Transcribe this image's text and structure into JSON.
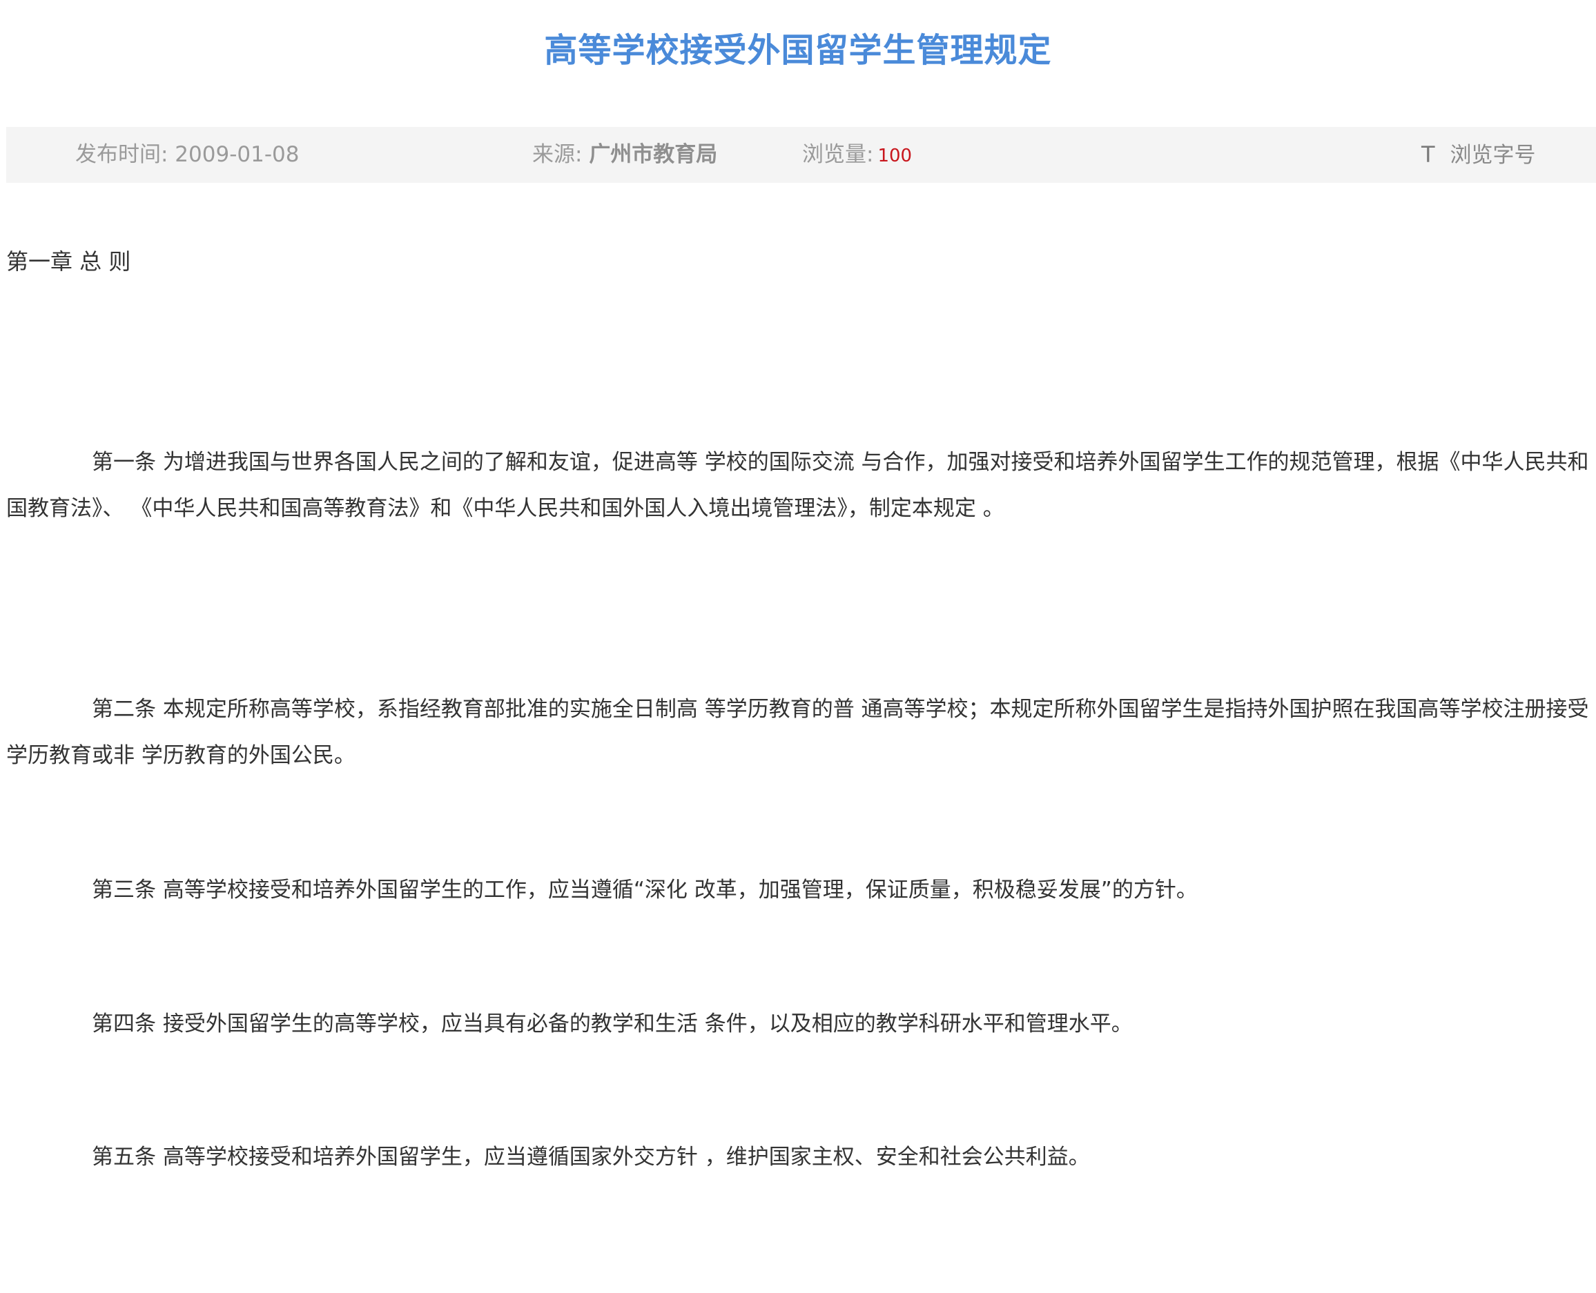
{
  "article": {
    "title": "高等学校接受外国留学生管理规定"
  },
  "meta": {
    "date_label": "发布时间: 2009-01-08",
    "source_label": "来源: ",
    "source_value": "广州市教育局",
    "views_label": "浏览量:",
    "views_value": "100",
    "font_icon": "T",
    "font_label": "浏览字号"
  },
  "body": {
    "chapter": "第一章 总 则",
    "paragraphs": [
      "第一条 为增进我国与世界各国人民之间的了解和友谊，促进高等 学校的国际交流 与合作，加强对接受和培养外国留学生工作的规范管理，根据《中华人民共和国教育法》、 《中华人民共和国高等教育法》和《中华人民共和国外国人入境出境管理法》，制定本规定 。",
      "第二条 本规定所称高等学校，系指经教育部批准的实施全日制高 等学历教育的普 通高等学校；本规定所称外国留学生是指持外国护照在我国高等学校注册接受学历教育或非 学历教育的外国公民。",
      "第三条 高等学校接受和培养外国留学生的工作，应当遵循“深化 改革，加强管理，保证质量，积极稳妥发展”的方针。",
      "第四条 接受外国留学生的高等学校，应当具有必备的教学和生活 条件，以及相应的教学科研水平和管理水平。",
      "第五条 高等学校接受和培养外国留学生，应当遵循国家外交方针 ，维护国家主权、安全和社会公共利益。"
    ]
  }
}
